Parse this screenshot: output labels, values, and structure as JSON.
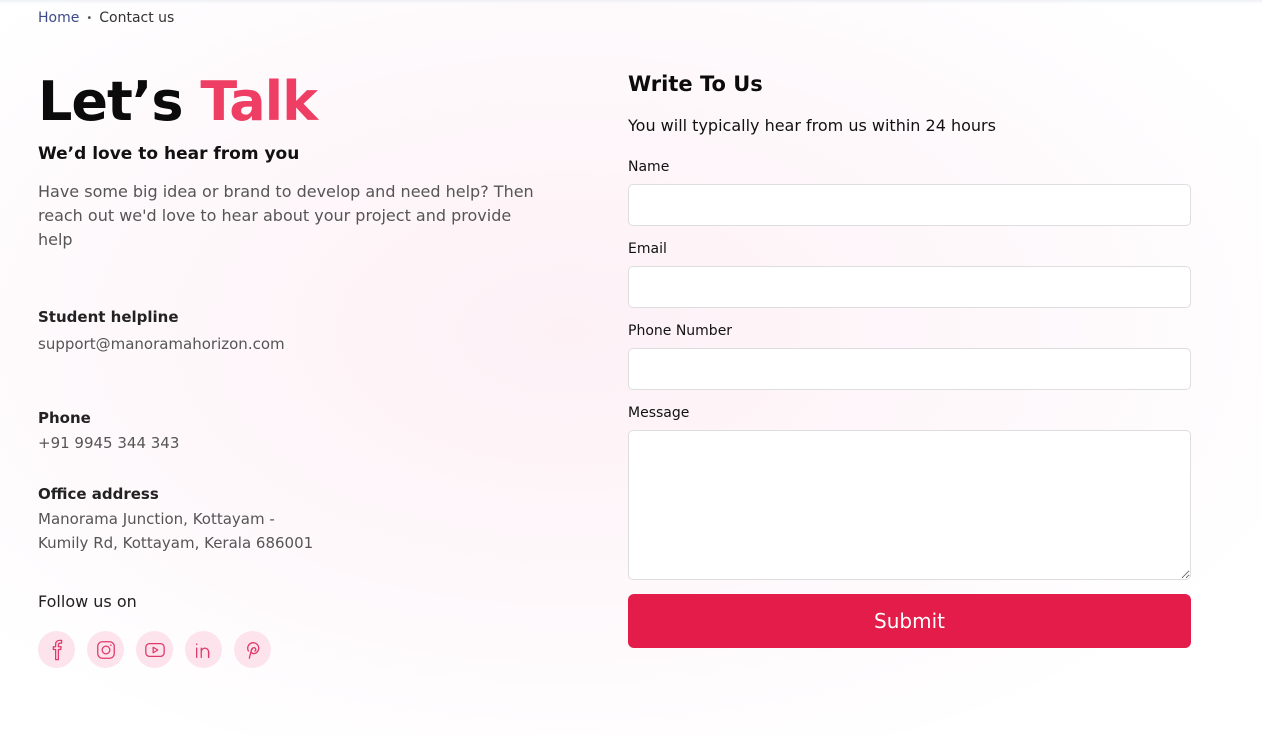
{
  "breadcrumb": {
    "home": "Home",
    "separator": "•",
    "current": "Contact us"
  },
  "hero": {
    "title_part1": "Let’s",
    "title_part2": "Talk",
    "subtitle": "We’d love to hear from you",
    "intro": "Have some big idea or brand to develop and need help? Then reach out we'd love to hear about your project and provide help"
  },
  "contacts": {
    "helpline_title": "Student helpline",
    "helpline_value": "support@manoramahorizon.com",
    "phone_title": "Phone",
    "phone_value": "+91 9945 344 343",
    "office_title": "Office address",
    "office_line1": "Manorama Junction, Kottayam -",
    "office_line2": "Kumily Rd, Kottayam, Kerala 686001"
  },
  "social": {
    "label": "Follow us on",
    "icons": [
      "facebook-icon",
      "instagram-icon",
      "youtube-icon",
      "linkedin-icon",
      "pinterest-icon"
    ]
  },
  "form": {
    "title": "Write To Us",
    "subtitle": "You will typically hear from us within 24 hours",
    "name_label": "Name",
    "name_value": "",
    "email_label": "Email",
    "email_value": "",
    "phone_label": "Phone Number",
    "phone_value": "",
    "message_label": "Message",
    "message_value": "",
    "submit_label": "Submit"
  },
  "colors": {
    "accent": "#ee3e63",
    "button": "#e31c4a",
    "icon_bg": "#fde4ec",
    "link": "#3b4a8a"
  }
}
